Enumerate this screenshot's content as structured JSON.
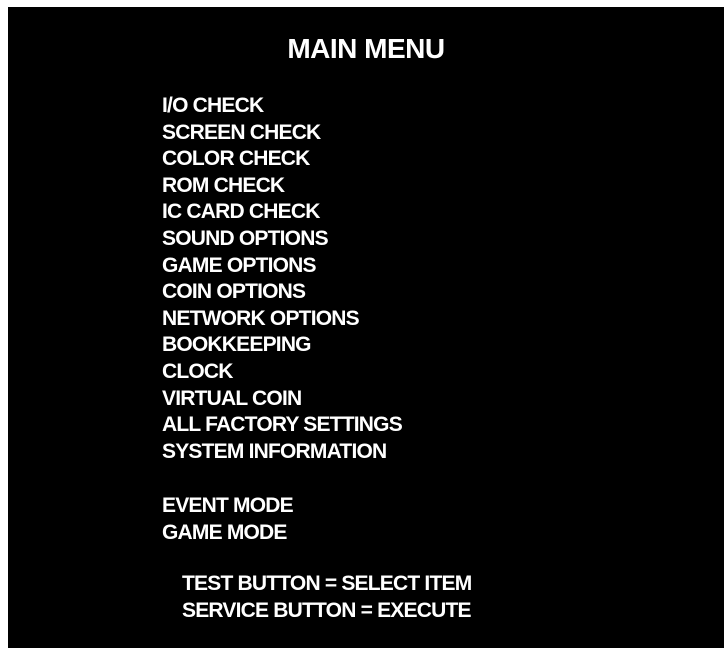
{
  "title": "MAIN MENU",
  "menu_items": [
    {
      "label": "I/O CHECK"
    },
    {
      "label": "SCREEN CHECK"
    },
    {
      "label": "COLOR CHECK"
    },
    {
      "label": "ROM CHECK"
    },
    {
      "label": "IC CARD CHECK"
    },
    {
      "label": "SOUND OPTIONS"
    },
    {
      "label": "GAME OPTIONS"
    },
    {
      "label": "COIN OPTIONS"
    },
    {
      "label": "NETWORK OPTIONS"
    },
    {
      "label": "BOOKKEEPING"
    },
    {
      "label": "CLOCK"
    },
    {
      "label": "VIRTUAL COIN"
    },
    {
      "label": "ALL FACTORY SETTINGS"
    },
    {
      "label": "SYSTEM INFORMATION"
    }
  ],
  "mode_items": [
    {
      "label": "EVENT MODE"
    },
    {
      "label": "GAME MODE"
    }
  ],
  "instructions": {
    "test_button": "TEST BUTTON = SELECT ITEM",
    "service_button": "SERVICE BUTTON = EXECUTE"
  },
  "colors": {
    "background": "#000000",
    "text": "#ffffff"
  }
}
